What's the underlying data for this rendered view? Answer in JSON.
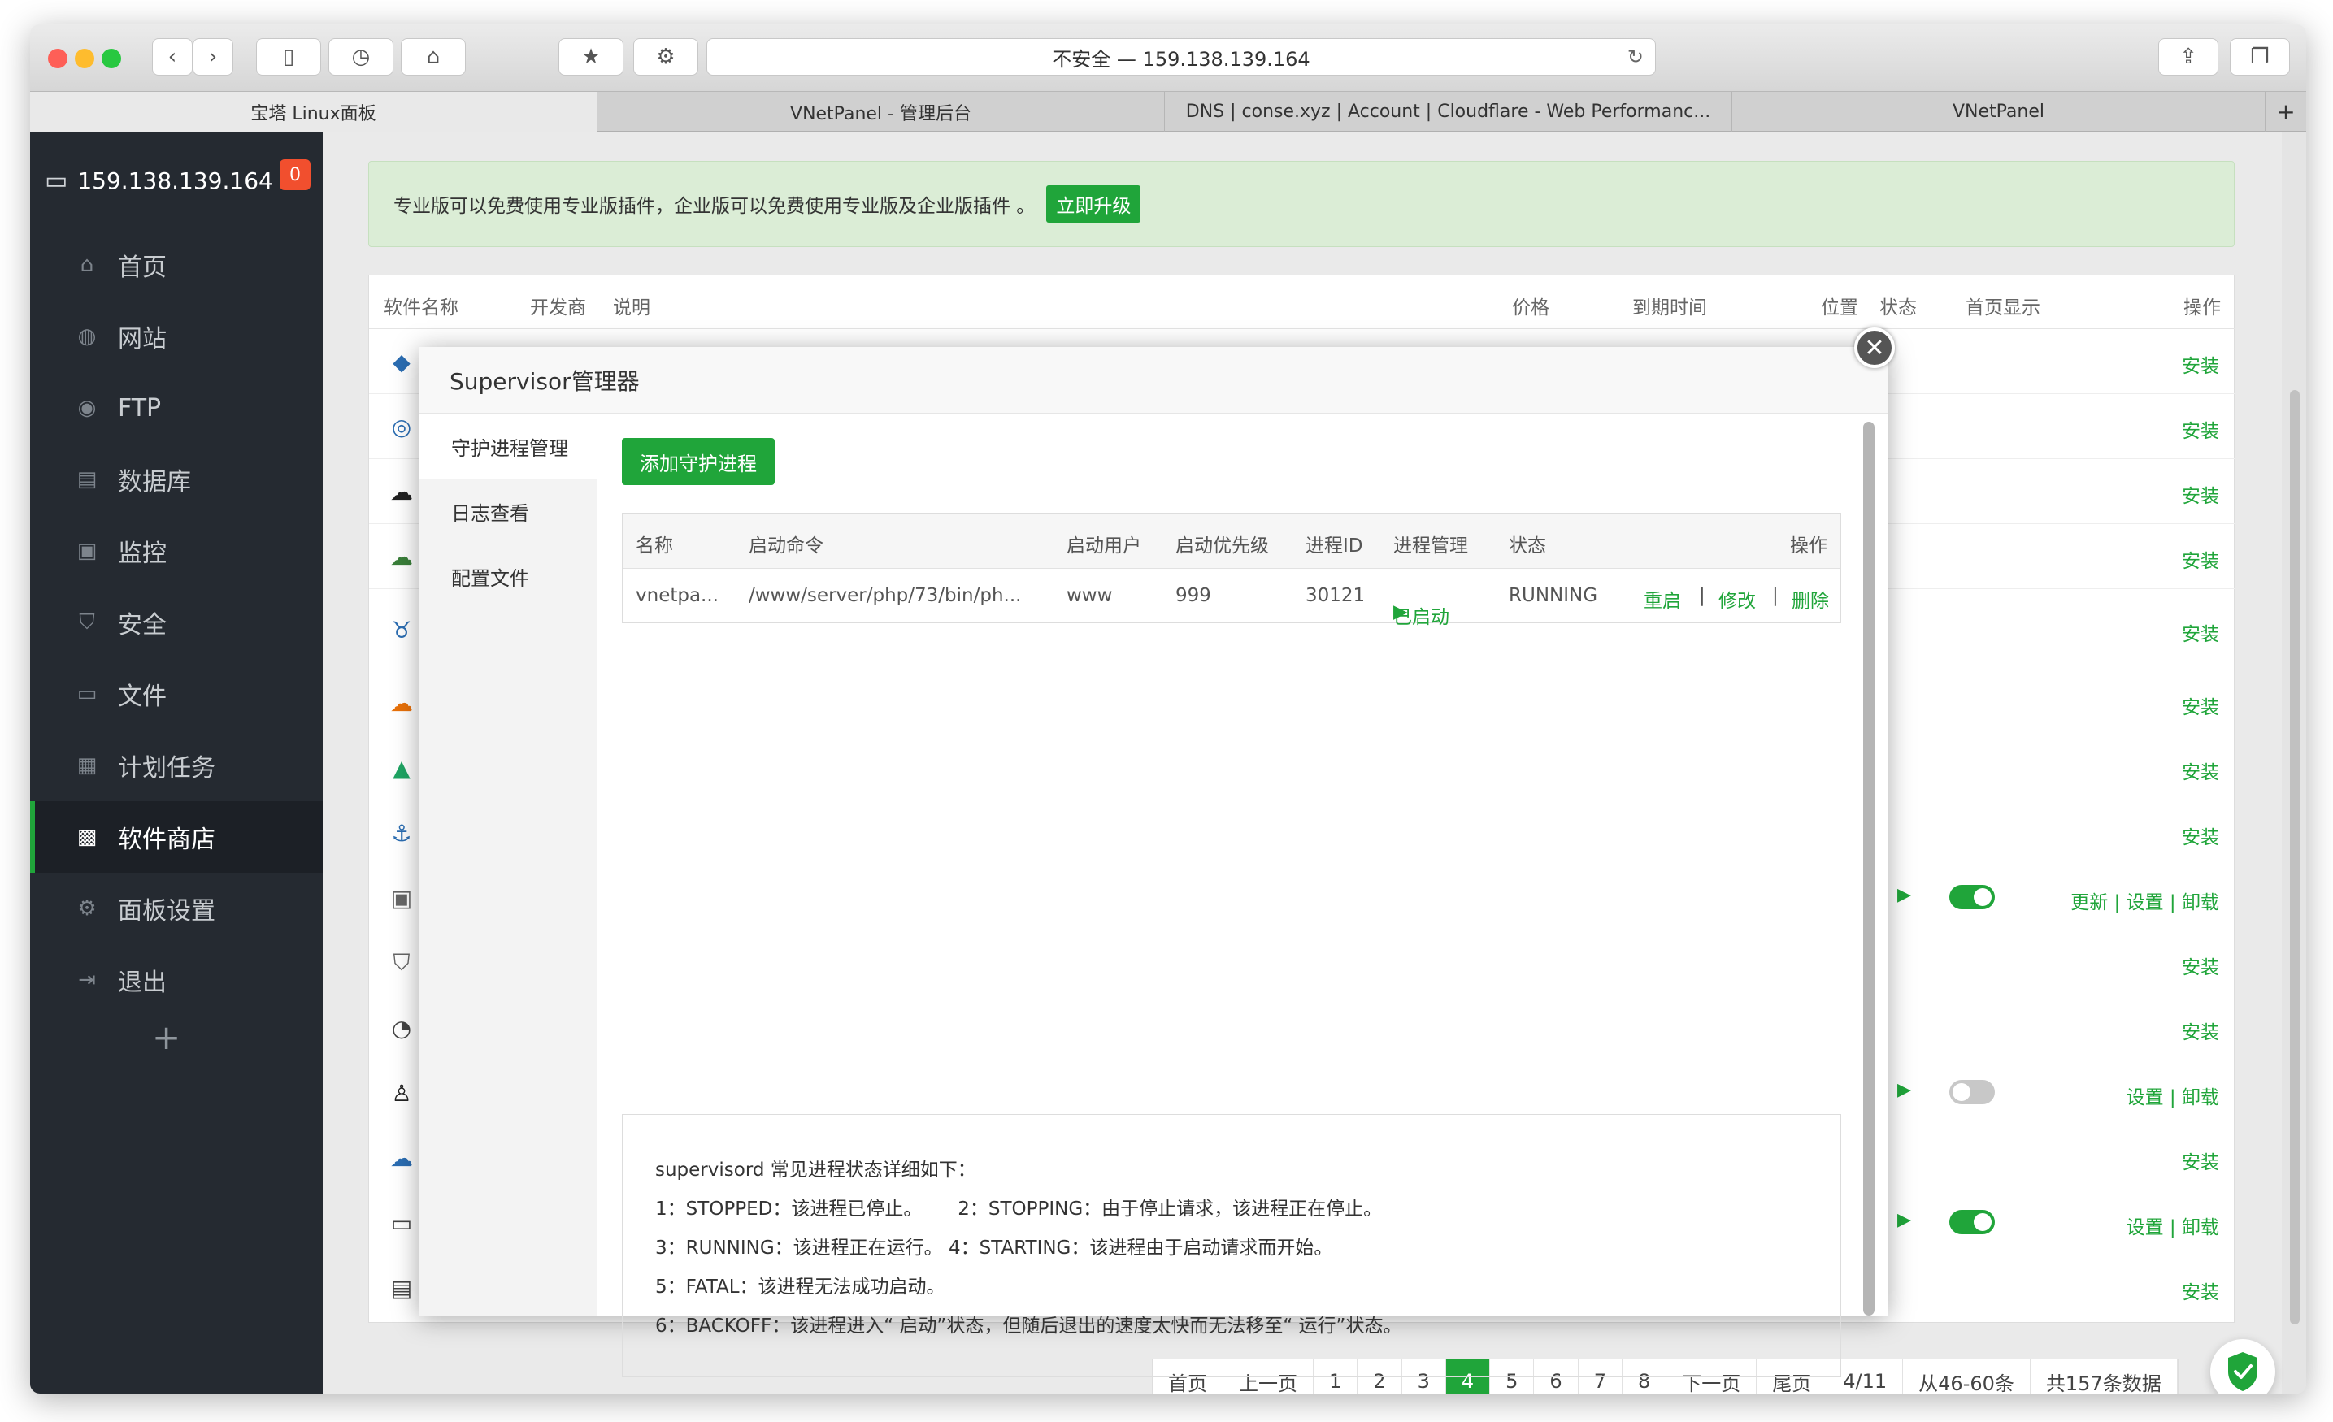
{
  "browser": {
    "address": "不安全 — 159.138.139.164",
    "tabs": [
      {
        "label": "宝塔 Linux面板"
      },
      {
        "label": "VNetPanel - 管理后台"
      },
      {
        "label": "DNS | conse.xyz | Account | Cloudflare - Web Performanc..."
      },
      {
        "label": "VNetPanel"
      }
    ],
    "new_tab": "+"
  },
  "sidebar": {
    "host": "159.138.139.164",
    "badge": "0",
    "items": [
      {
        "label": "首页",
        "icon": "home-icon"
      },
      {
        "label": "网站",
        "icon": "globe-icon"
      },
      {
        "label": "FTP",
        "icon": "user-icon"
      },
      {
        "label": "数据库",
        "icon": "database-icon"
      },
      {
        "label": "监控",
        "icon": "monitor-icon"
      },
      {
        "label": "安全",
        "icon": "shield-icon"
      },
      {
        "label": "文件",
        "icon": "folder-icon"
      },
      {
        "label": "计划任务",
        "icon": "calendar-icon"
      },
      {
        "label": "软件商店",
        "icon": "grid-icon"
      },
      {
        "label": "面板设置",
        "icon": "gear-icon"
      },
      {
        "label": "退出",
        "icon": "logout-icon"
      }
    ],
    "add": "+"
  },
  "notice": {
    "text": "专业版可以免费使用专业版插件，企业版可以免费使用专业版及企业版插件 。",
    "upgrade": "立即升级"
  },
  "software_table": {
    "headers": [
      "软件名称",
      "开发商",
      "说明",
      "价格",
      "到期时间",
      "位置",
      "状态",
      "首页显示",
      "操作"
    ],
    "rows": [
      {
        "action": "安装"
      },
      {
        "action": "安装"
      },
      {
        "action": "安装"
      },
      {
        "action": "安装"
      },
      {
        "action": "安装"
      },
      {
        "action": "安装"
      },
      {
        "action": "安装"
      },
      {
        "action": "安装"
      },
      {
        "action": "更新 | 设置 | 卸载"
      },
      {
        "action": "安装"
      },
      {
        "action": "安装"
      },
      {
        "action": "设置 | 卸载"
      },
      {
        "action": "安装"
      },
      {
        "action": "设置 | 卸载"
      },
      {
        "action": "安装"
      }
    ]
  },
  "pager": {
    "items": [
      "首页",
      "上一页",
      "1",
      "2",
      "3",
      "4",
      "5",
      "6",
      "7",
      "8",
      "下一页",
      "尾页",
      "4/11",
      "从46-60条",
      "共157条数据"
    ],
    "current": "4"
  },
  "modal": {
    "title": "Supervisor管理器",
    "close": "✕",
    "tabs": [
      "守护进程管理",
      "日志查看",
      "配置文件"
    ],
    "add_button": "添加守护进程",
    "headers": [
      "名称",
      "启动命令",
      "启动用户",
      "启动优先级",
      "进程ID",
      "进程管理",
      "状态",
      "操作"
    ],
    "row": {
      "name": "vnetpa...",
      "command": "/www/server/php/73/bin/ph...",
      "user": "www",
      "priority": "999",
      "pid": "30121",
      "manage": "已启动",
      "status": "RUNNING",
      "restart": "重启",
      "edit": "修改",
      "delete": "删除",
      "sep": "|"
    },
    "info": [
      "supervisord 常见进程状态详细如下：",
      "1：STOPPED：该进程已停止。      2：STOPPING：由于停止请求，该进程正在停止。",
      "3：RUNNING：该进程正在运行。 4：STARTING：该进程由于启动请求而开始。",
      "5：FATAL：该进程无法成功启动。",
      "6：BACKOFF：该进程进入“ 启动”状态，但随后退出的速度太快而无法移至“ 运行”状态。"
    ]
  },
  "colors": {
    "accent": "#20a53a",
    "sidebar": "#252a31",
    "badge": "#f14f2e"
  }
}
